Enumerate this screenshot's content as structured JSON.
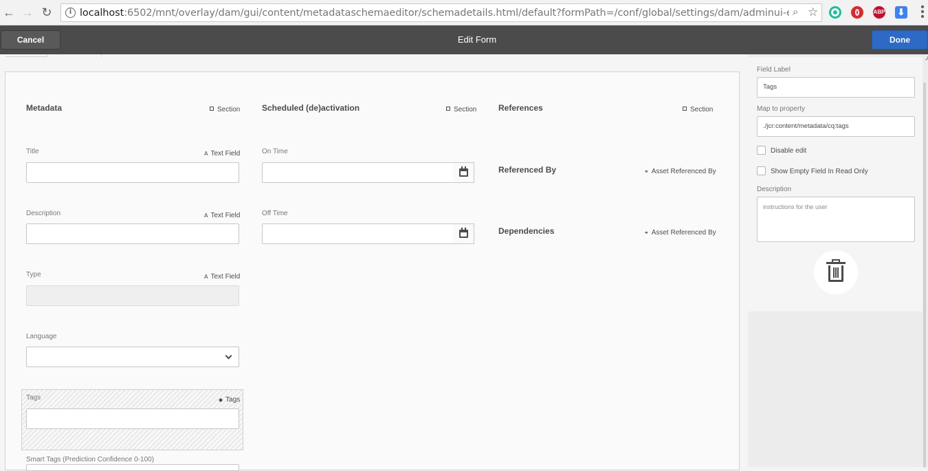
{
  "browser": {
    "back_icon": "arrow-left-icon",
    "forward_icon": "arrow-right-icon",
    "reload_icon": "reload-icon",
    "url_host": "localhost",
    "url_rest": ":6502/mnt/overlay/dam/gui/content/metadataschemaeditor/schemadetails.html/default?formPath=/conf/global/settings/dam/adminui-extension/metadatasc",
    "extensions": [
      {
        "name": "grammarly-icon",
        "color": "#15c39a",
        "label": ""
      },
      {
        "name": "opera-icon",
        "color": "#e0262b",
        "label": ""
      },
      {
        "name": "adblock-plus-icon",
        "color": "#c70d2c",
        "label": "ABP"
      },
      {
        "name": "download-icon",
        "color": "#3b82f6",
        "label": ""
      }
    ]
  },
  "actionbar": {
    "cancel_label": "Cancel",
    "title": "Edit Form",
    "done_label": "Done"
  },
  "form": {
    "columns": [
      {
        "title": "Metadata",
        "type": "Section"
      },
      {
        "title": "Scheduled (de)activation",
        "type": "Section"
      },
      {
        "title": "References",
        "type": "Section"
      }
    ],
    "metadata_fields": {
      "title": {
        "label": "Title",
        "type": "Text Field"
      },
      "description": {
        "label": "Description",
        "type": "Text Field"
      },
      "type": {
        "label": "Type",
        "type": "Text Field"
      },
      "language": {
        "label": "Language"
      },
      "tags": {
        "label": "Tags",
        "type": "Tags"
      },
      "smart_tags": {
        "label": "Smart Tags (Prediction Confidence 0-100)"
      }
    },
    "schedule_fields": {
      "on_time": {
        "label": "On Time"
      },
      "off_time": {
        "label": "Off Time"
      }
    },
    "references": {
      "referenced_by": {
        "label": "Referenced By",
        "type": "Asset Referenced By"
      },
      "dependencies": {
        "label": "Dependencies",
        "type": "Asset Referenced By"
      }
    }
  },
  "side_panel": {
    "field_label_label": "Field Label",
    "field_label_value": "Tags",
    "map_to_property_label": "Map to property",
    "map_to_property_value": "./jcr:content/metadata/cq:tags",
    "disable_edit_label": "Disable edit",
    "disable_edit_checked": false,
    "show_empty_label": "Show Empty Field In Read Only",
    "show_empty_checked": false,
    "description_label": "Description",
    "description_placeholder": "instructions for the user",
    "delete_icon": "trash-icon"
  }
}
